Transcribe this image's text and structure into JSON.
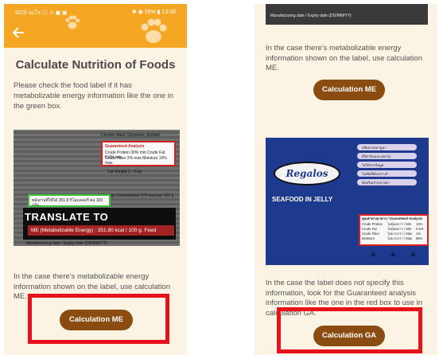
{
  "left": {
    "status_left": "SOS อะไร ⓘ ⚠ ◼ ▣",
    "status_right": "✱ ◉ 59% ▮ 13:08",
    "title": "Calculate Nutrition of Foods",
    "intro": "Please check the food label if it has metabolizable energy information like the one in the green box.",
    "photo": {
      "red_box_lines": [
        "Guaranteed Analysis",
        "Crude Protein 30% min  Crude Fat 5.0% min",
        "Crude Fiber 3% max  Moisture 10% max"
      ],
      "green_box_text": "พลังงานที่ใช้ได้ 351.8 กิโลแคลอรี ต่อ 100 กรัม",
      "translate_title": "TRANSLATE TO",
      "me_bar": "ME (Metabolizable Energy) : 351.80 kcal / 100 g. Feed",
      "label_text_1": "Chicken Meal, Glycerine, Sorbitol,",
      "label_text_2": "Cat Weight 1 - 5 kg",
      "label_text_3": "Energy Consumption 370 kcal per 100 g",
      "footer_text": "Manufacturing date / Expiry date (DD/MM/YY)"
    },
    "body": "In the case there's metabolizable energy information shown on the label, use calculation ME.",
    "button": "Calculation ME"
  },
  "right": {
    "top_strip_text": "Manufacturing date / Expiry date (DD/MM/YY)",
    "body_me": "In the case there's metabolizable energy information shown on the label, use calculation ME.",
    "button_me": "Calculation ME",
    "pouch": {
      "brand": "Regalos",
      "product": "SEAFOOD IN JELLY",
      "chips": [
        "ผลิตจากปลาทูน่า",
        "มีวิตามินและแร่ธาตุ",
        "ไม่ใส่สารกันบูด",
        "ไม่เจือสีสังเคราะห์",
        "มีทอรีนบำรุงสายตา"
      ],
      "ga_title": "คุณค่าทางอาหาร / Guaranteed Analysis",
      "ga_rows": [
        [
          "Crude Protein",
          "ไม่น้อยกว่า / Min",
          "10%"
        ],
        [
          "Crude Fat",
          "ไม่น้อยกว่า / Min",
          "0.5%"
        ],
        [
          "Crude Fiber",
          "ไม่มากกว่า / Max",
          "1%"
        ],
        [
          "Moisture",
          "ไม่มากกว่า / Max",
          "85%"
        ]
      ]
    },
    "body_ga": "In the case the label does not specify this information, look for the Guaranteed analysis information like the one in the red box to use in calculation GA.",
    "button_ga": "Calculation GA"
  },
  "colors": {
    "appbar": "#f5a623",
    "background": "#fbf3e3",
    "button": "#8b4c11",
    "highlight": "#e8121d",
    "green_box": "#3cc13b"
  },
  "icons": [
    "back-arrow-icon",
    "paw-icon"
  ]
}
